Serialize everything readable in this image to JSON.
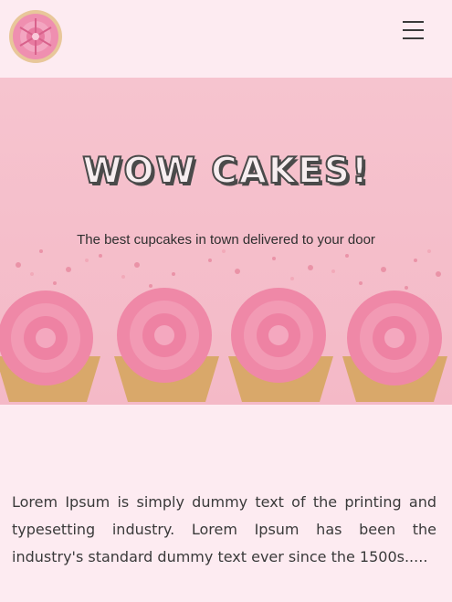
{
  "header": {
    "logo_icon": "cupcake-logo-icon",
    "menu_icon": "hamburger-menu-icon"
  },
  "hero": {
    "title": "WOW CAKES!",
    "tagline": "The best cupcakes in town delivered to your door",
    "image_icon": "pink-cupcakes-image"
  },
  "intro": {
    "text": "Lorem Ipsum is simply dummy text of the printing and typesetting industry. Lorem Ipsum has been the industry's standard dummy text ever since the 1500s....."
  },
  "colors": {
    "page_background": "#fdebf1",
    "hero_background": "#f6c4cf",
    "frosting": "#f07f9f",
    "title_fill": "#f7eef0",
    "title_outline": "#4a4a4a",
    "text": "#3a3a3a"
  }
}
